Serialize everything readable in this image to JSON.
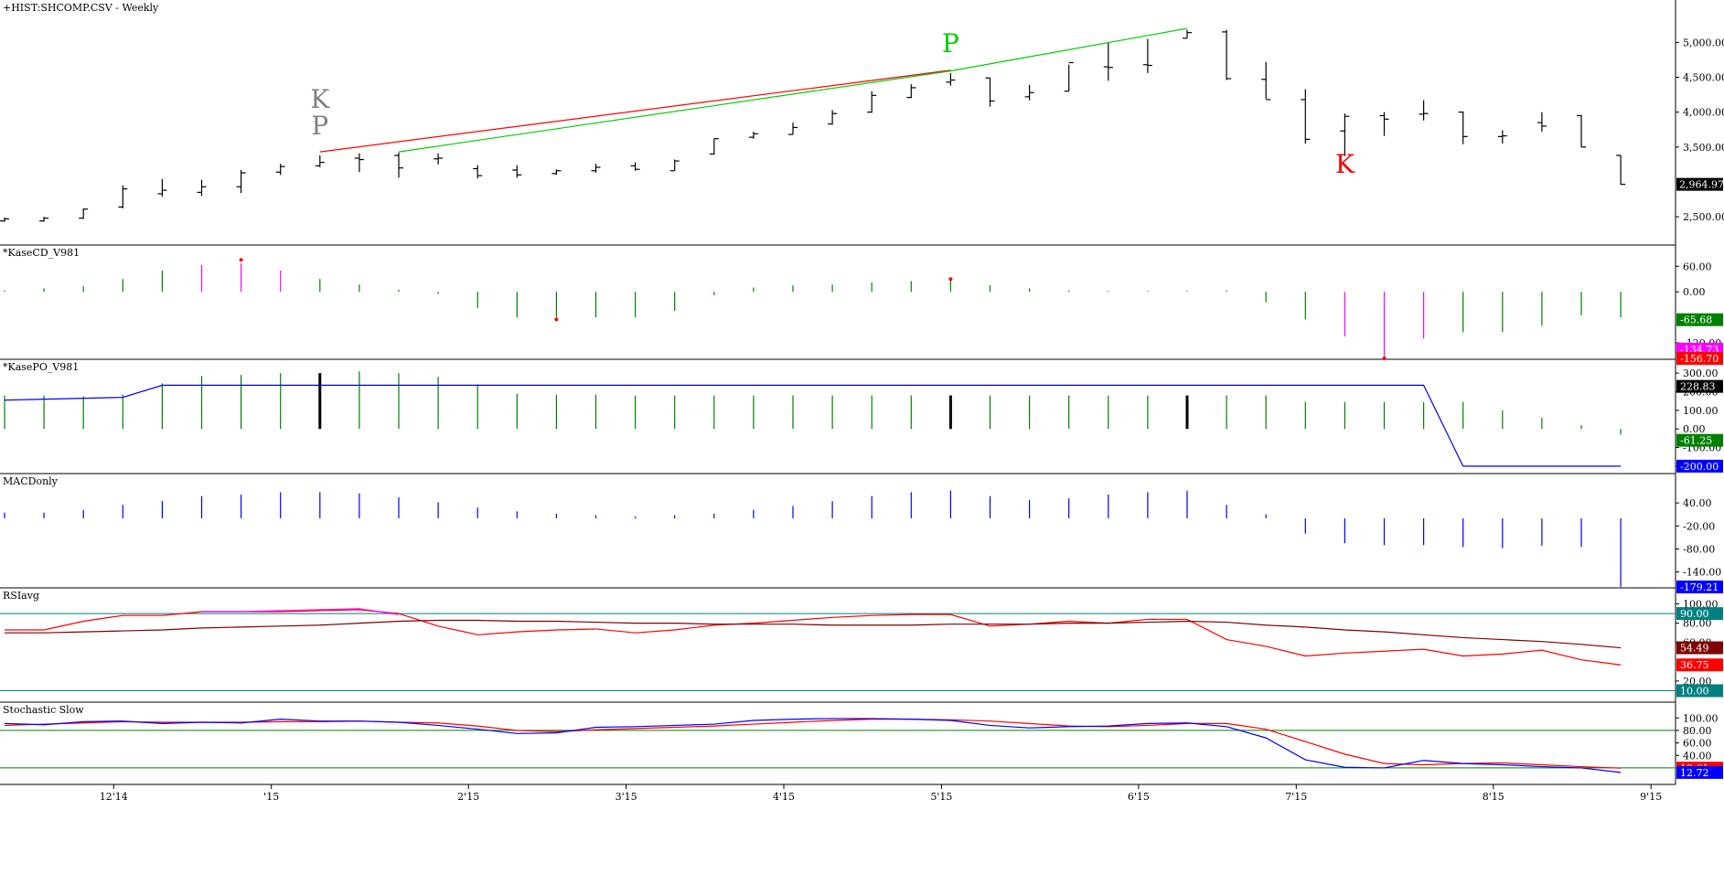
{
  "window": {
    "title": "+HIST:SHCOMP.CSV - Weekly"
  },
  "x_axis": {
    "labels": [
      {
        "text": "12'14",
        "bar": 3
      },
      {
        "text": "'15",
        "bar": 7
      },
      {
        "text": "2'15",
        "bar": 12
      },
      {
        "text": "3'15",
        "bar": 16
      },
      {
        "text": "4'15",
        "bar": 20
      },
      {
        "text": "5'15",
        "bar": 24
      },
      {
        "text": "6'15",
        "bar": 29
      },
      {
        "text": "7'15",
        "bar": 33
      },
      {
        "text": "8'15",
        "bar": 38
      },
      {
        "text": "9'15",
        "bar": 42
      }
    ]
  },
  "colors": {
    "price_bar": "#000000",
    "green": "#008000",
    "magenta": "#ff00ff",
    "red": "#ff0000",
    "blue": "#0000ff",
    "teal": "#008080",
    "darkred": "#800000",
    "gray": "#808080",
    "bright_green": "#00cc00"
  },
  "chart_data": [
    {
      "type": "ohlc",
      "name": "price",
      "title": "+HIST:SHCOMP.CSV - Weekly",
      "ylim": [
        2200,
        5450
      ],
      "yticks": [
        {
          "v": 5000,
          "label": "5,000.00"
        },
        {
          "v": 4500,
          "label": "4,500.00"
        },
        {
          "v": 4000,
          "label": "4,000.00"
        },
        {
          "v": 3500,
          "label": "3,500.00"
        },
        {
          "v": 2500,
          "label": "2,500.00"
        }
      ],
      "last_value": {
        "v": 2964.97,
        "label": "2,964.97"
      },
      "bars": [
        [
          2440,
          2490,
          2430,
          2470
        ],
        [
          2440,
          2500,
          2430,
          2480
        ],
        [
          2480,
          2620,
          2470,
          2610
        ],
        [
          2640,
          2950,
          2620,
          2900
        ],
        [
          2830,
          3040,
          2790,
          2880
        ],
        [
          2850,
          3030,
          2800,
          2930
        ],
        [
          2930,
          3170,
          2840,
          3130
        ],
        [
          3140,
          3260,
          3100,
          3220
        ],
        [
          3230,
          3380,
          3210,
          3280
        ],
        [
          3340,
          3410,
          3140,
          3320
        ],
        [
          3380,
          3420,
          3060,
          3200
        ],
        [
          3330,
          3410,
          3250,
          3340
        ],
        [
          3190,
          3240,
          3050,
          3090
        ],
        [
          3170,
          3240,
          3060,
          3100
        ],
        [
          3120,
          3180,
          3100,
          3160
        ],
        [
          3160,
          3260,
          3130,
          3210
        ],
        [
          3230,
          3280,
          3160,
          3180
        ],
        [
          3160,
          3320,
          3160,
          3300
        ],
        [
          3400,
          3620,
          3390,
          3620
        ],
        [
          3640,
          3720,
          3620,
          3690
        ],
        [
          3680,
          3850,
          3680,
          3780
        ],
        [
          3830,
          4030,
          3820,
          3980
        ],
        [
          4000,
          4300,
          3990,
          4240
        ],
        [
          4210,
          4400,
          4200,
          4350
        ],
        [
          4430,
          4560,
          4380,
          4460
        ],
        [
          4490,
          4490,
          4080,
          4160
        ],
        [
          4220,
          4390,
          4170,
          4280
        ],
        [
          4300,
          4680,
          4300,
          4710
        ],
        [
          4650,
          5000,
          4450,
          4640
        ],
        [
          4680,
          5050,
          4560,
          4670
        ],
        [
          5060,
          5180,
          5060,
          5140
        ],
        [
          5150,
          5180,
          4460,
          4480
        ],
        [
          4470,
          4720,
          4190,
          4180
        ],
        [
          4180,
          4330,
          3550,
          3610
        ],
        [
          3730,
          3980,
          3370,
          3940
        ],
        [
          3950,
          4000,
          3660,
          3900
        ],
        [
          3970,
          4170,
          3880,
          3980
        ],
        [
          4000,
          4010,
          3540,
          3650
        ],
        [
          3650,
          3740,
          3550,
          3660
        ],
        [
          3850,
          4000,
          3720,
          3800
        ],
        [
          3950,
          3960,
          3500,
          3500
        ],
        [
          3380,
          3380,
          2960,
          2964.97
        ]
      ],
      "annotations": [
        {
          "text": "K",
          "color": "#808080",
          "bar": 8,
          "v": 4060
        },
        {
          "text": "P",
          "color": "#808080",
          "bar": 8,
          "v": 3680
        },
        {
          "text": "P",
          "color": "#00cc00",
          "bar": 24,
          "v": 4860
        },
        {
          "text": "K",
          "color": "#ff0000",
          "bar": 34,
          "v": 3130
        }
      ],
      "trendlines": [
        {
          "color": "#ff0000",
          "from": [
            8,
            3430
          ],
          "to": [
            24,
            4600
          ]
        },
        {
          "color": "#00cc00",
          "from": [
            10,
            3430
          ],
          "to": [
            24,
            4590
          ]
        },
        {
          "color": "#00cc00",
          "from": [
            24,
            4590
          ],
          "to": [
            30,
            5200
          ]
        }
      ]
    },
    {
      "type": "bar",
      "name": "KaseCD",
      "title": "*KaseCD_V981",
      "ylim": [
        -156.7,
        95
      ],
      "yticks": [
        {
          "v": 60,
          "label": "60.00"
        },
        {
          "v": 0,
          "label": "0.00"
        },
        {
          "v": -120,
          "label": "-120.00"
        }
      ],
      "values": [
        3,
        8,
        13,
        30,
        50,
        63,
        67,
        50,
        30,
        17,
        5,
        -5,
        -38,
        -60,
        -60,
        -60,
        -60,
        -45,
        -8,
        10,
        15,
        17,
        22,
        25,
        27,
        15,
        8,
        3,
        2,
        2,
        2,
        3,
        -25,
        -65,
        -105,
        -156.7,
        -110,
        -95,
        -95,
        -80,
        -55,
        -60
      ],
      "colors": [
        "g",
        "g",
        "g",
        "g",
        "g",
        "m",
        "m",
        "m",
        "g",
        "g",
        "g",
        "g",
        "g",
        "g",
        "g",
        "g",
        "g",
        "g",
        "g",
        "g",
        "g",
        "g",
        "g",
        "g",
        "g",
        "g",
        "g",
        "g",
        "g",
        "g",
        "g",
        "g",
        "g",
        "g",
        "m",
        "m",
        "m",
        "g",
        "g",
        "g",
        "g",
        "g"
      ],
      "dots": [
        {
          "bar": 6,
          "v": 75
        },
        {
          "bar": 14,
          "v": -65
        },
        {
          "bar": 24,
          "v": 30
        },
        {
          "bar": 35,
          "v": -156.7
        }
      ],
      "badges": [
        {
          "label": "-65.68",
          "v": -65.68,
          "color": "#008000"
        },
        {
          "label": "-134.73",
          "v": -134.73,
          "color": "#ff00ff"
        },
        {
          "label": "-156.70",
          "v": -156.7,
          "color": "#ff0000"
        }
      ]
    },
    {
      "type": "bar",
      "name": "KasePO",
      "title": "*KasePO_V981",
      "ylim": [
        -235,
        340
      ],
      "yticks": [
        {
          "v": 300,
          "label": "300.00"
        },
        {
          "v": 200,
          "label": "200.00"
        },
        {
          "v": 100,
          "label": "100.00"
        },
        {
          "v": 0,
          "label": "0.00"
        },
        {
          "v": -100,
          "label": "-100.00"
        },
        {
          "v": -200,
          "label": "-200.00"
        }
      ],
      "values": [
        140,
        148,
        160,
        190,
        240,
        270,
        285,
        290,
        300,
        300,
        300,
        300,
        290,
        275,
        255,
        245,
        245,
        245,
        245,
        245,
        245,
        245,
        245,
        245,
        245,
        245,
        245,
        245,
        245,
        245,
        245,
        245,
        245,
        245,
        245,
        245,
        245,
        245,
        200,
        160,
        120,
        70
      ],
      "bold_bars": [
        8,
        24,
        30
      ],
      "pos_bars_override": [
        180,
        180,
        175,
        185,
        245,
        285,
        290,
        300,
        300,
        310,
        300,
        280,
        240,
        190,
        185,
        185,
        180,
        180,
        180,
        180,
        180,
        180,
        180,
        180,
        180,
        180,
        180,
        180,
        180,
        180,
        180,
        180,
        180,
        180,
        180,
        180,
        180,
        180,
        180,
        180,
        180,
        180
      ],
      "line": {
        "color": "#0000ff",
        "points": [
          [
            0,
            155
          ],
          [
            1,
            160
          ],
          [
            2,
            165
          ],
          [
            3,
            170
          ],
          [
            4,
            235
          ],
          [
            36,
            235
          ],
          [
            37,
            -200
          ],
          [
            41,
            -200
          ]
        ]
      },
      "badges": [
        {
          "label": "228.83",
          "v": 228.83,
          "color": "#000000"
        },
        {
          "label": "-61.25",
          "v": -61.25,
          "color": "#008000"
        },
        {
          "label": "-200.00",
          "v": -200,
          "color": "#0000ff"
        }
      ]
    },
    {
      "type": "bar",
      "name": "MACDonly",
      "title": "MACDonly",
      "ylim": [
        -179.21,
        100
      ],
      "yticks": [
        {
          "v": 40,
          "label": "40.00"
        },
        {
          "v": -20,
          "label": "-20.00"
        },
        {
          "v": -80,
          "label": "-80.00"
        },
        {
          "v": -140,
          "label": "-140.00"
        }
      ],
      "values": [
        15,
        15,
        22,
        35,
        45,
        58,
        62,
        68,
        68,
        65,
        55,
        42,
        28,
        18,
        12,
        8,
        5,
        8,
        12,
        22,
        32,
        45,
        58,
        68,
        72,
        58,
        48,
        52,
        62,
        68,
        72,
        35,
        10,
        -40,
        -65,
        -70,
        -70,
        -75,
        -78,
        -72,
        -75,
        -179.21
      ],
      "badges": [
        {
          "label": "-179.21",
          "v": -179.21,
          "color": "#0000ff"
        }
      ]
    },
    {
      "type": "line",
      "name": "RSIavg",
      "title": "RSIavg",
      "ylim": [
        0,
        110
      ],
      "yticks": [
        {
          "v": 100,
          "label": "100.00"
        },
        {
          "v": 80,
          "label": "80.00"
        },
        {
          "v": 60,
          "label": "60.00"
        },
        {
          "v": 20,
          "label": "20.00"
        }
      ],
      "hlines": [
        {
          "v": 90,
          "color": "#008080"
        },
        {
          "v": 10,
          "color": "#008080"
        }
      ],
      "series": [
        {
          "color": "#ff0000",
          "values": [
            73,
            73,
            82,
            88,
            88,
            92,
            92,
            92,
            93,
            94,
            90,
            77,
            68,
            71,
            73,
            74,
            70,
            73,
            78,
            80,
            83,
            86,
            88,
            89,
            89,
            77,
            79,
            82,
            80,
            84,
            84,
            63,
            56,
            46,
            49,
            51,
            53,
            46,
            48,
            52,
            42,
            36.75
          ]
        },
        {
          "color": "#800000",
          "values": [
            70,
            70,
            71,
            72,
            73,
            75,
            76,
            77,
            78,
            80,
            82,
            83,
            83,
            82,
            82,
            81,
            80,
            80,
            79,
            79,
            79,
            78,
            78,
            78,
            79,
            79,
            79,
            80,
            80,
            81,
            82,
            81,
            78,
            76,
            73,
            71,
            68,
            65,
            63,
            61,
            58,
            54.49
          ]
        },
        {
          "color": "#ff00ff",
          "values": [
            null,
            null,
            null,
            null,
            null,
            92,
            92,
            93,
            94,
            95,
            89,
            null,
            null,
            null,
            null,
            null,
            null,
            null,
            null,
            null,
            null,
            null,
            null,
            null,
            null,
            null,
            null,
            null,
            null,
            null,
            null,
            null,
            null,
            null,
            null,
            null,
            null,
            null,
            null,
            null,
            null,
            null
          ]
        }
      ],
      "badges": [
        {
          "label": "90.00",
          "v": 90,
          "color": "#008080"
        },
        {
          "label": "54.49",
          "v": 54.49,
          "color": "#800000"
        },
        {
          "label": "36.75",
          "v": 36.75,
          "color": "#ff0000"
        },
        {
          "label": "10.00",
          "v": 10,
          "color": "#008080"
        }
      ]
    },
    {
      "type": "line",
      "name": "StochasticSlow",
      "title": "Stochastic Slow",
      "ylim": [
        -5,
        115
      ],
      "yticks": [
        {
          "v": 100,
          "label": "100.00"
        },
        {
          "v": 80,
          "label": "80.00"
        },
        {
          "v": 60,
          "label": "60.00"
        },
        {
          "v": 40,
          "label": "40.00"
        }
      ],
      "hlines": [
        {
          "v": 80,
          "color": "#008000"
        },
        {
          "v": 20,
          "color": "#008000"
        }
      ],
      "series": [
        {
          "color": "#ff0000",
          "values": [
            88,
            90,
            92,
            94,
            93,
            93,
            93,
            94,
            94,
            95,
            93,
            92,
            87,
            80,
            78,
            81,
            83,
            85,
            87,
            90,
            93,
            96,
            98,
            98,
            97,
            95,
            91,
            87,
            86,
            88,
            91,
            91,
            82,
            62,
            42,
            27,
            25,
            27,
            28,
            25,
            22,
            19.61
          ]
        },
        {
          "color": "#0000ff",
          "values": [
            91,
            89,
            94,
            95,
            91,
            93,
            92,
            98,
            95,
            95,
            93,
            88,
            82,
            75,
            76,
            85,
            86,
            88,
            90,
            96,
            98,
            99,
            99,
            98,
            96,
            88,
            84,
            86,
            87,
            91,
            92,
            86,
            68,
            33,
            21,
            20,
            32,
            27,
            25,
            22,
            20,
            12.72
          ]
        }
      ],
      "badges": [
        {
          "label": "19.61",
          "v": 19.61,
          "color": "#ff0000"
        },
        {
          "label": "12.72",
          "v": 12.72,
          "color": "#0000ff"
        }
      ]
    }
  ]
}
